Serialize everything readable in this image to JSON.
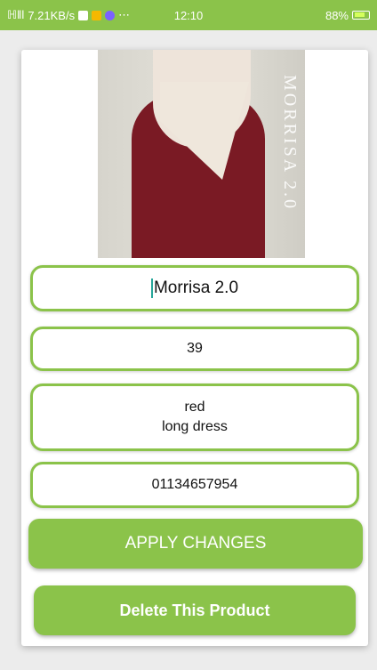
{
  "status_bar": {
    "signal": "ℍ‖l",
    "speed": "7.21KB/s",
    "time": "12:10",
    "battery": "88%"
  },
  "product": {
    "image_brand": "MORRISA 2.0",
    "name": "Morrisa 2.0",
    "price": "39",
    "description_line1": "red",
    "description_line2": "long dress",
    "phone": "01134657954"
  },
  "actions": {
    "apply_label": "APPLY CHANGES",
    "delete_label": "Delete This Product"
  },
  "colors": {
    "accent": "#8bc34a",
    "dress": "#7a1a24"
  }
}
